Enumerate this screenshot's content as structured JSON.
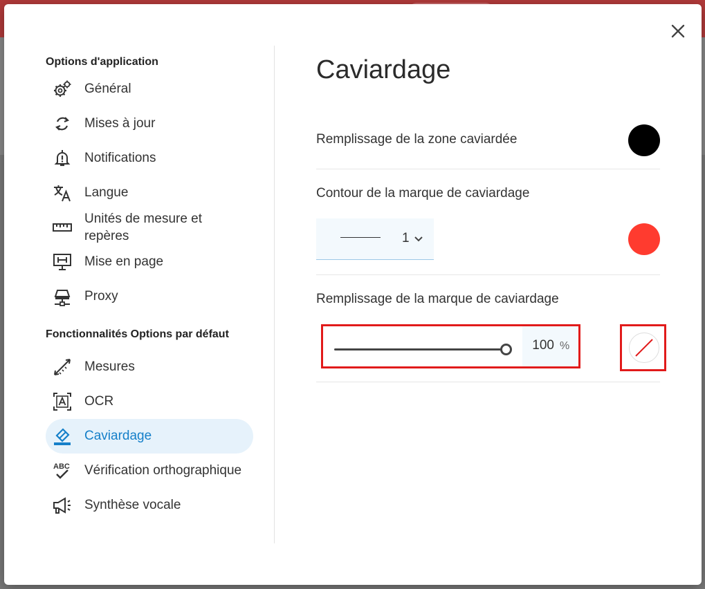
{
  "sidebar": {
    "app_section": "Options d'application",
    "app_items": [
      {
        "label": "Général",
        "icon": "gear-icon"
      },
      {
        "label": "Mises à jour",
        "icon": "refresh-icon"
      },
      {
        "label": "Notifications",
        "icon": "bell-alert-icon"
      },
      {
        "label": "Langue",
        "icon": "translate-icon"
      },
      {
        "label_line1": "Unités de mesure et",
        "label_line2": "repères",
        "icon": "ruler-icon"
      },
      {
        "label": "Mise en page",
        "icon": "page-layout-icon"
      },
      {
        "label": "Proxy",
        "icon": "network-icon"
      }
    ],
    "features_section": "Fonctionnalités Options par défaut",
    "feature_items": [
      {
        "label": "Mesures",
        "icon": "measure-icon"
      },
      {
        "label": "OCR",
        "icon": "ocr-icon"
      },
      {
        "label": "Caviardage",
        "icon": "eraser-icon",
        "active": true
      },
      {
        "label": "Vérification orthographique",
        "icon": "spellcheck-icon"
      },
      {
        "label": "Synthèse vocale",
        "icon": "megaphone-icon"
      }
    ]
  },
  "main": {
    "title": "Caviardage",
    "fill_area_label": "Remplissage de la zone caviardée",
    "fill_area_color": "#000000",
    "outline_label": "Contour de la marque de caviardage",
    "outline_width": "1",
    "outline_color": "#ff3b2f",
    "mark_fill_label": "Remplissage de la marque de caviardage",
    "mark_fill_opacity": "100",
    "mark_fill_unit": "%",
    "mark_fill_color": "none"
  },
  "colors": {
    "accent": "#1680c9",
    "active_bg": "#e6f2fb",
    "highlight": "#e11a1a"
  }
}
